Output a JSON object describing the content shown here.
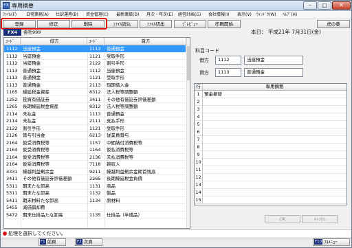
{
  "window": {
    "title": "専用摘要",
    "app_icon": "FX",
    "controls": {
      "minimize": "–",
      "maximize": "□",
      "close": "✕"
    }
  },
  "menu": [
    "ﾌｧｲﾙ(F)",
    "日常業務(A)",
    "仕訳運用(B)",
    "資金管理(C)",
    "最新業績(D)",
    "月次・年次(E)",
    "経営計画(G)",
    "会社情報(I)",
    "表示(V)",
    "ｳｨﾝﾄﾞｳ(W)",
    "ﾍﾙﾌﾟ(H)"
  ],
  "toolbar": {
    "register": "登録",
    "edit": "修正",
    "delete": "削除",
    "file_load": "ﾌｧｲﾙ読込",
    "file_export": "ﾌｧｲﾙ切出",
    "preview": "ﾌﾟﾚﾋﾞｭｰ",
    "print_start": "印刷開始",
    "tiger_scroll": "虎の巻"
  },
  "subheader": {
    "fx4": "FX4",
    "company": "会社999",
    "date": "本日：  平成21年  7月31日(金)"
  },
  "table": {
    "headers": {
      "code1": "ｺｰﾄﾞ",
      "debit": "借方",
      "code2": "ｺｰﾄﾞ",
      "credit": "貸方"
    },
    "rows": [
      [
        "1112",
        "当座預金",
        "1113",
        "普通預金"
      ],
      [
        "1112",
        "当座預金",
        "1121",
        "受取手形"
      ],
      [
        "1112",
        "当座預金",
        "2122",
        "割引手形"
      ],
      [
        "1113",
        "普通預金",
        "1112",
        "当座預金"
      ],
      [
        "1113",
        "普通預金",
        "1121",
        "受取手形"
      ],
      [
        "1113",
        "普通預金",
        "2113",
        "短期借入金"
      ],
      [
        "1165",
        "繰延税金資産",
        "8312",
        "法人税等調整額"
      ],
      [
        "1252",
        "投資有価証券",
        "3411",
        "その他有価証券評価差額"
      ],
      [
        "1265",
        "長期繰延税金資産",
        "8312",
        "法人税等調整額"
      ],
      [
        "2114",
        "未払金",
        "1113",
        "普通預金"
      ],
      [
        "2114",
        "未払金",
        "2111",
        "支払手形"
      ],
      [
        "2122",
        "割引手形",
        "1121",
        "受取手形"
      ],
      [
        "2126",
        "賞与引当金",
        "6213",
        "従業員賞与"
      ],
      [
        "2164",
        "仮受消費税等",
        "1157",
        "中間納付消費税等"
      ],
      [
        "2164",
        "仮受消費税等",
        "1164",
        "仮払消費税等"
      ],
      [
        "2164",
        "仮受消費税等",
        "2136",
        "未払消費税等"
      ],
      [
        "2164",
        "仮受消費税等",
        "7118",
        "雑収入"
      ],
      [
        "3331",
        "繰越利益剰余金",
        "9211",
        "繰越利益剰余金期首残高"
      ],
      [
        "3411",
        "その他有価証券評価差額",
        "2265",
        "長期繰延税金負債"
      ],
      [
        "5311",
        "期末たな卸高",
        "1131",
        "商品"
      ],
      [
        "5311",
        "期末たな卸高",
        "1132",
        "製品"
      ],
      [
        "5411",
        "期末材料たな卸高",
        "1134",
        "原材料"
      ],
      [
        "5455",
        "減価償却費",
        "",
        ""
      ],
      [
        "5472",
        "期末仕掛品たな卸高",
        "1135",
        "仕掛品（半成品）"
      ]
    ],
    "selected_index": 0
  },
  "detail": {
    "section_label": "科目コード",
    "debit_label": "借方",
    "debit_code": "1112",
    "debit_name": "当座預金",
    "credit_label": "貸方",
    "credit_code": "1113",
    "credit_name": "普通預金"
  },
  "memo": {
    "header_no": "行",
    "header_text": "専用摘要",
    "rows": [
      {
        "no": "1",
        "text": "預金振替"
      },
      {
        "no": "2",
        "text": ""
      },
      {
        "no": "3",
        "text": ""
      },
      {
        "no": "4",
        "text": ""
      },
      {
        "no": "5",
        "text": ""
      },
      {
        "no": "6",
        "text": ""
      },
      {
        "no": "7",
        "text": ""
      },
      {
        "no": "8",
        "text": ""
      },
      {
        "no": "9",
        "text": ""
      },
      {
        "no": "10",
        "text": ""
      },
      {
        "no": "11",
        "text": ""
      },
      {
        "no": "12",
        "text": ""
      },
      {
        "no": "13",
        "text": ""
      },
      {
        "no": "14",
        "text": ""
      },
      {
        "no": "15",
        "text": ""
      }
    ]
  },
  "dialog_buttons": {
    "ok": "OK",
    "cancel": "ｷｬﾝｾﾙ"
  },
  "status": {
    "message": "処理を選択してください。"
  },
  "fkeys": [
    {
      "key": "F1",
      "label": "前頁"
    },
    {
      "key": "F2",
      "label": "次頁"
    },
    {
      "key": "F10",
      "label": "ﾌﾙﾒﾆｭｰ"
    }
  ],
  "colors": {
    "selection": "#3399ff",
    "fx4_bg": "#1a2f7a",
    "highlight_ring": "#e01010"
  }
}
